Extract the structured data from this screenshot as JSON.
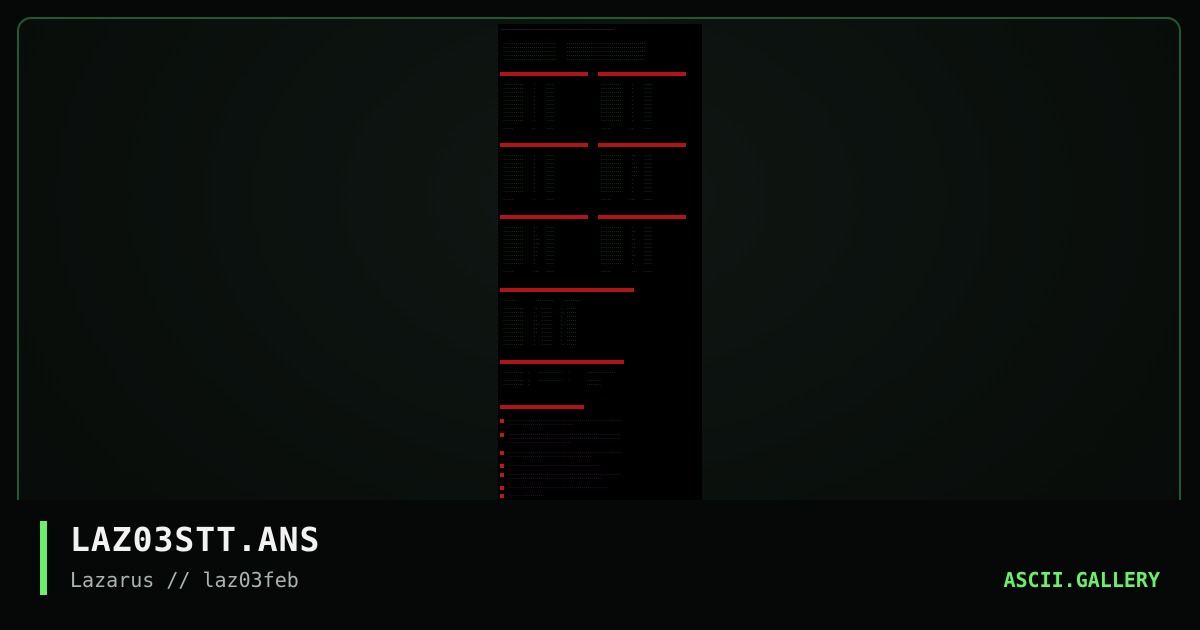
{
  "artwork": {
    "description_alt": "ANSI art text-mode statistics file"
  },
  "info": {
    "title": "LAZ03STT.ANS",
    "subtitle": "Lazarus // laz03feb"
  },
  "brand": {
    "label": "ASCII.GALLERY"
  },
  "colors": {
    "accent": "#6cf06c",
    "frame_border": "#1f5a32",
    "background": "#050806"
  }
}
